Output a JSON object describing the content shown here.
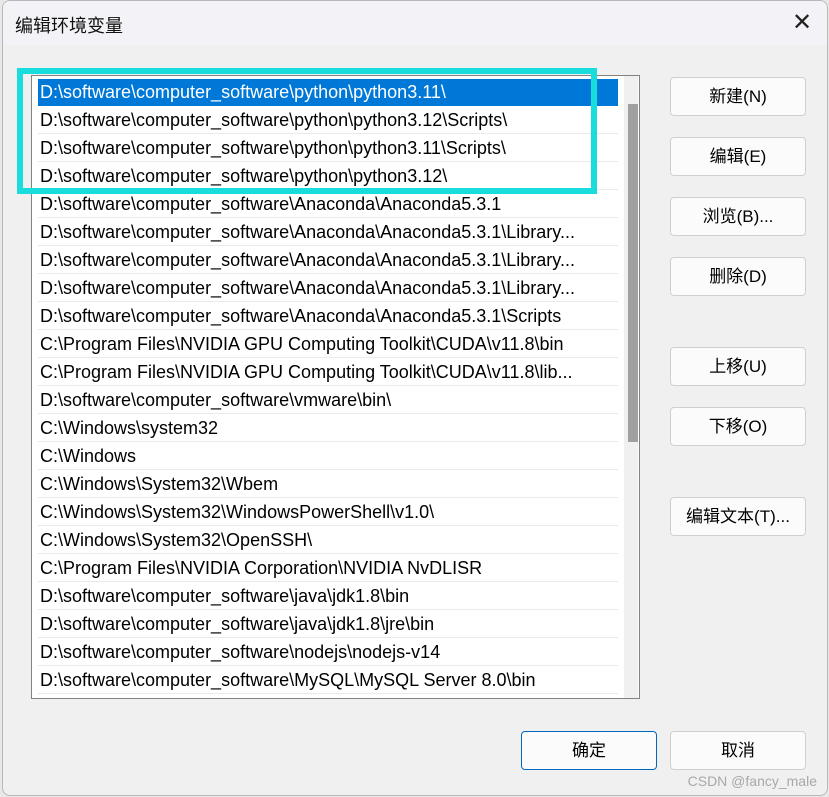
{
  "window": {
    "title": "编辑环境变量",
    "close_icon": "close-icon"
  },
  "paths": [
    "D:\\software\\computer_software\\python\\python3.11\\",
    "D:\\software\\computer_software\\python\\python3.12\\Scripts\\",
    "D:\\software\\computer_software\\python\\python3.11\\Scripts\\",
    "D:\\software\\computer_software\\python\\python3.12\\",
    "D:\\software\\computer_software\\Anaconda\\Anaconda5.3.1",
    "D:\\software\\computer_software\\Anaconda\\Anaconda5.3.1\\Library...",
    "D:\\software\\computer_software\\Anaconda\\Anaconda5.3.1\\Library...",
    "D:\\software\\computer_software\\Anaconda\\Anaconda5.3.1\\Library...",
    "D:\\software\\computer_software\\Anaconda\\Anaconda5.3.1\\Scripts",
    "C:\\Program Files\\NVIDIA GPU Computing Toolkit\\CUDA\\v11.8\\bin",
    "C:\\Program Files\\NVIDIA GPU Computing Toolkit\\CUDA\\v11.8\\lib...",
    "D:\\software\\computer_software\\vmware\\bin\\",
    "C:\\Windows\\system32",
    "C:\\Windows",
    "C:\\Windows\\System32\\Wbem",
    "C:\\Windows\\System32\\WindowsPowerShell\\v1.0\\",
    "C:\\Windows\\System32\\OpenSSH\\",
    "C:\\Program Files\\NVIDIA Corporation\\NVIDIA NvDLISR",
    "D:\\software\\computer_software\\java\\jdk1.8\\bin",
    "D:\\software\\computer_software\\java\\jdk1.8\\jre\\bin",
    "D:\\software\\computer_software\\nodejs\\nodejs-v14",
    "D:\\software\\computer_software\\MySQL\\MySQL Server 8.0\\bin"
  ],
  "selected_index": 0,
  "buttons": {
    "new": "新建(N)",
    "edit": "编辑(E)",
    "browse": "浏览(B)...",
    "delete": "删除(D)",
    "move_up": "上移(U)",
    "move_down": "下移(O)",
    "edit_text": "编辑文本(T)...",
    "ok": "确定",
    "cancel": "取消"
  },
  "watermark": "CSDN @fancy_male",
  "colors": {
    "selection": "#0078d7",
    "highlight_box": "#19dcdc"
  }
}
